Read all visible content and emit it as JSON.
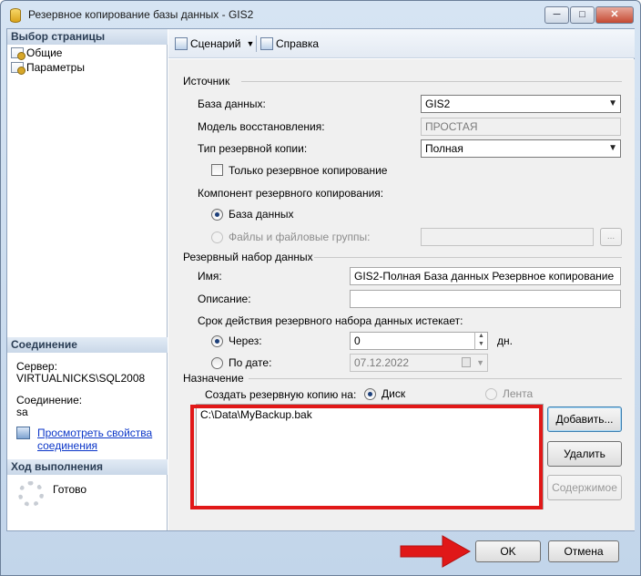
{
  "window": {
    "title": "Резервное копирование базы данных - GIS2",
    "minimize": "─",
    "maximize": "□",
    "close": "✕"
  },
  "left_pane": {
    "select_page_header": "Выбор страницы",
    "pages": [
      {
        "label": "Общие",
        "icon": "page-icon"
      },
      {
        "label": "Параметры",
        "icon": "page-icon"
      }
    ],
    "connection_header": "Соединение",
    "server_label": "Сервер:",
    "server_value": "VIRTUALNICKS\\SQL2008",
    "connection_label": "Соединение:",
    "connection_value": "sa",
    "view_connection_link_line1": "Просмотреть свойства",
    "view_connection_link_line2": "соединения",
    "progress_header": "Ход выполнения",
    "progress_status": "Готово"
  },
  "toolbar": {
    "script_label": "Сценарий",
    "help_label": "Справка"
  },
  "source": {
    "group_label": "Источник",
    "database_label": "База данных:",
    "database_value": "GIS2",
    "recovery_model_label": "Модель восстановления:",
    "recovery_model_value": "ПРОСТАЯ",
    "backup_type_label": "Тип резервной копии:",
    "backup_type_value": "Полная",
    "copy_only_label": "Только резервное копирование",
    "copy_only_checked": false,
    "component_label": "Компонент резервного копирования:",
    "component_database_label": "База данных",
    "component_files_label": "Файлы и файловые группы:",
    "component_selected": "database",
    "files_browse_label": "..."
  },
  "backup_set": {
    "group_label": "Резервный набор данных",
    "name_label": "Имя:",
    "name_value": "GIS2-Полная База данных Резервное копирование",
    "description_label": "Описание:",
    "description_value": "",
    "expires_label": "Срок действия резервного набора данных истекает:",
    "after_label": "Через:",
    "after_value": "0",
    "after_unit": "дн.",
    "on_date_label": "По дате:",
    "on_date_value": "07.12.2022",
    "expires_selected": "after"
  },
  "destination": {
    "group_label": "Назначение",
    "backup_to_label": "Создать резервную копию на:",
    "disk_label": "Диск",
    "tape_label": "Лента",
    "selected": "disk",
    "paths": [
      "C:\\Data\\MyBackup.bak"
    ],
    "add_button": "Добавить...",
    "remove_button": "Удалить",
    "contents_button": "Содержимое"
  },
  "footer": {
    "ok_button": "OK",
    "cancel_button": "Отмена"
  },
  "colors": {
    "highlight_red": "#e11818",
    "link_blue": "#0b36c8",
    "title_gradient_top": "#d6e4f3"
  }
}
